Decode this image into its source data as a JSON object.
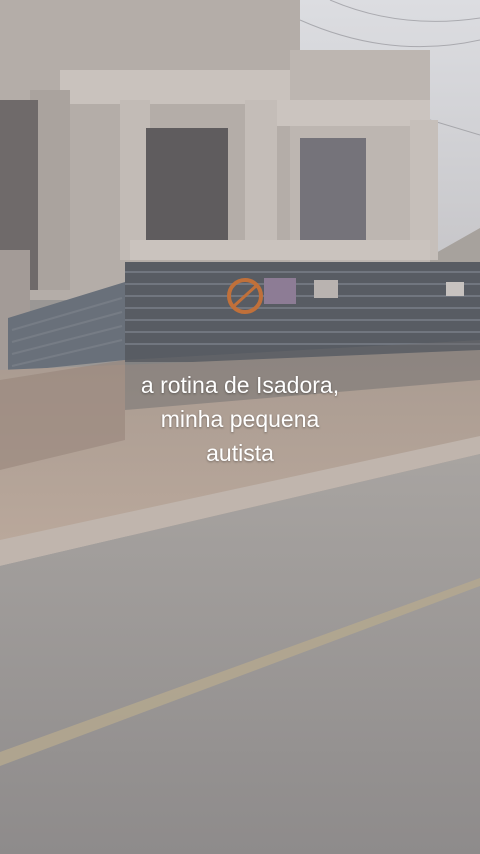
{
  "video": {
    "caption_lines": [
      "a rotina de Isadora,",
      "minha pequena",
      "autista"
    ]
  },
  "scene": {
    "colors": {
      "sky": "#cfcfd3",
      "building": "#b9b3ae",
      "building_shadow": "#8f8a88",
      "fence": "#5d6168",
      "ground": "#b5a59a",
      "road": "#9a9795",
      "road_line": "#b8a98a"
    }
  }
}
